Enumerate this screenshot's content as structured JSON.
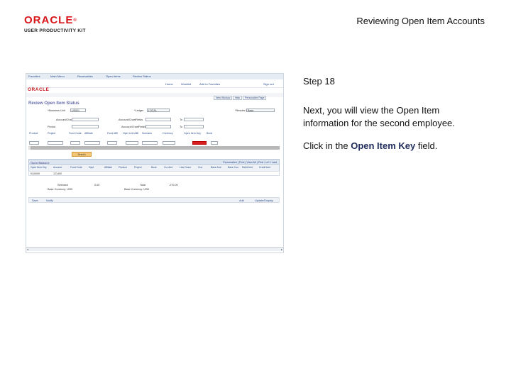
{
  "slide": {
    "title": "Reviewing Open Item Accounts",
    "logo_top": "ORACLE",
    "logo_mark": "®",
    "logo_bottom": "USER PRODUCTIVITY KIT"
  },
  "instructions": {
    "step": "Step 18",
    "text": "Next, you will view the Open Item information for the second employee.",
    "click_prefix": "Click in the ",
    "click_target": "Open Item Key",
    "click_suffix": " field."
  },
  "screenshot": {
    "menu_items": [
      "Favorites",
      "Main Menu",
      "Receivables",
      "Open Items",
      "Review Status"
    ],
    "top_nav": [
      "Home",
      "Worklist",
      "Add to Favorites",
      "Sign out"
    ],
    "mini_logo": "ORACLE",
    "header_links": [
      "New Window",
      "Help",
      "Personalize Page"
    ],
    "page_title": "Review Open Item Status",
    "labels": {
      "business_unit": "*Business Unit",
      "ledger": "*Ledger",
      "results_in": "*Results In",
      "account_chartfields": "Account/ChartFields",
      "to": "To",
      "period": "Period",
      "to2": "To"
    },
    "values": {
      "business_unit": "US001",
      "ledger": "LOCAL",
      "results_in": "Base"
    },
    "field_headers": [
      "Product",
      "Project",
      "Fund Code",
      "Affiliate",
      "Fund Affil",
      "Oper Unit Affil",
      "Scenario",
      "Currency",
      "Open Item Key",
      "Book"
    ],
    "search_button": "Search",
    "grid": {
      "title": "Open Balance",
      "nav": "Personalize | Find | View All | First  1 of 1  Last",
      "columns": [
        "Open Item Key",
        "Account",
        "Fund Code",
        "Dept",
        "Affiliate",
        "Product",
        "Project",
        "Book",
        "Cur Amt",
        "Line Descr",
        "Curr",
        "Base Amt",
        "Base Curr",
        "Debit Amt",
        "Credit Amt"
      ],
      "rows": [
        {
          "key": "KU0009",
          "account": "121400"
        }
      ]
    },
    "totals": {
      "selected_label": "Selected",
      "selected_value": "0.00",
      "selected_curr": "Base Currency: USD",
      "total_label": "Total",
      "total_value": "270.00",
      "total_curr": "Base Currency: USD"
    },
    "footer": {
      "save": "Save",
      "notify": "Notify",
      "add": "Add",
      "update": "Update/Display"
    }
  }
}
